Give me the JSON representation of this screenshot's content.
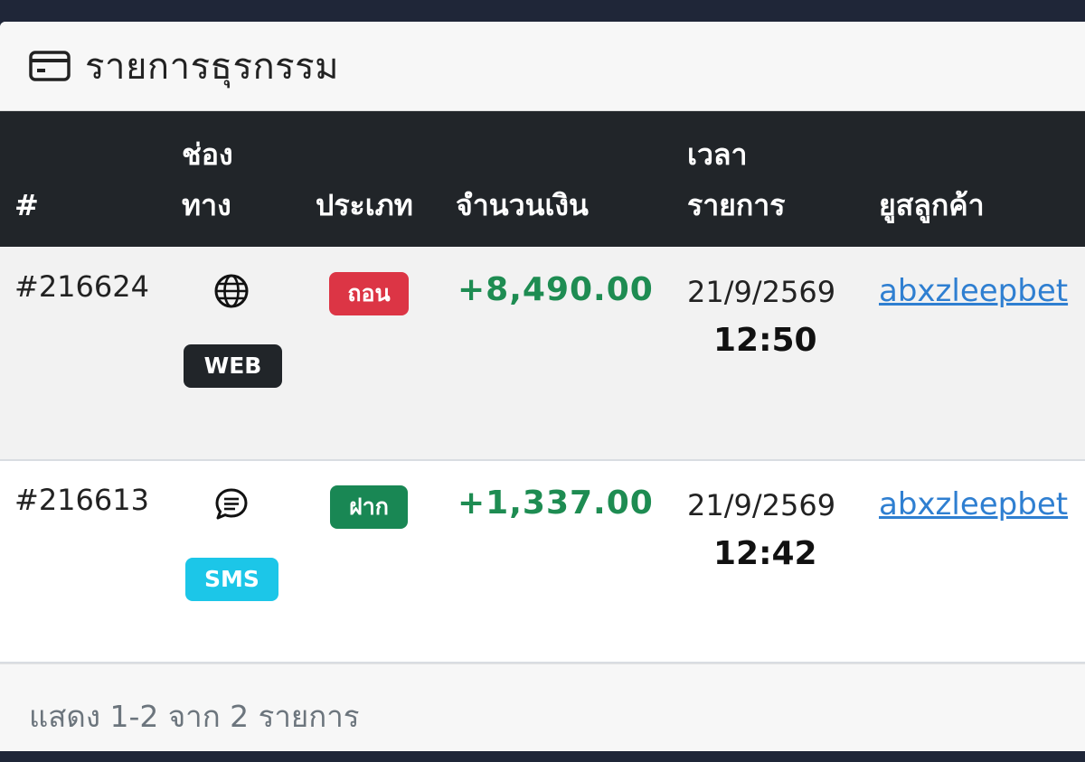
{
  "card": {
    "title": "รายการธุรกรรม",
    "icon": "credit-card-icon"
  },
  "table": {
    "headers": {
      "index": "#",
      "channel_line1": "ช่อง",
      "channel_line2": "ทาง",
      "type": "ประเภท",
      "amount": "จำนวนเงิน",
      "time_line1": "เวลา",
      "time_line2": "รายการ",
      "customer": "ยูสลูกค้า"
    },
    "rows": [
      {
        "id": "#216624",
        "channel_icon": "globe-icon",
        "channel": "WEB",
        "type": "ถอน",
        "amount": "+8,490.00",
        "date": "21/9/2569",
        "time": "12:50",
        "user": "abxzleepbet"
      },
      {
        "id": "#216613",
        "channel_icon": "chat-bubble-icon",
        "channel": "SMS",
        "type": "ฝาก",
        "amount": "+1,337.00",
        "date": "21/9/2569",
        "time": "12:42",
        "user": "abxzleepbet"
      }
    ]
  },
  "footer": {
    "summary": "แสดง 1-2 จาก 2 รายการ"
  },
  "colors": {
    "header_bg": "#212529",
    "withdraw": "#dc3545",
    "deposit": "#198754",
    "amount": "#1e8c52",
    "sms_badge": "#1cc6e8",
    "link": "#2f7fd1"
  }
}
